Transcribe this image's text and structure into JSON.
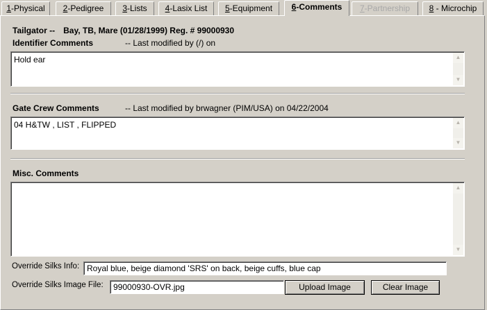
{
  "tabs": [
    {
      "key": "1",
      "label": "-Physical"
    },
    {
      "key": "2",
      "label": "-Pedigree"
    },
    {
      "key": "3",
      "label": "-Lists"
    },
    {
      "key": "4",
      "label": "-Lasix List"
    },
    {
      "key": "5",
      "label": "-Equipment"
    },
    {
      "key": "6",
      "label": "-Comments"
    },
    {
      "key": "7",
      "label": "-Partnership"
    },
    {
      "key": "8",
      "label": " - Microchip"
    }
  ],
  "active_tab": "6",
  "disabled_tab": "7",
  "header": {
    "horse_name": "Tailgator --",
    "details": "Bay, TB, Mare (01/28/1999) Reg. # 99000930"
  },
  "identifier_comments": {
    "title": "Identifier Comments",
    "modified": "-- Last modified by (/) on",
    "text": "Hold ear"
  },
  "gate_crew_comments": {
    "title": "Gate Crew Comments",
    "modified": "-- Last modified by brwagner (PIM/USA) on 04/22/2004",
    "text": "04 H&TW , LIST , FLIPPED"
  },
  "misc_comments": {
    "title": "Misc. Comments",
    "text": ""
  },
  "override_silks_info": {
    "label": "Override Silks Info:",
    "value": "Royal blue, beige diamond 'SRS' on back, beige cuffs, blue cap"
  },
  "override_silks_image": {
    "label": "Override Silks Image File:",
    "value": "99000930-OVR.jpg",
    "upload_label": "Upload Image",
    "clear_label": "Clear Image"
  },
  "scroll_icons": {
    "up": "▲",
    "down": "▼"
  }
}
